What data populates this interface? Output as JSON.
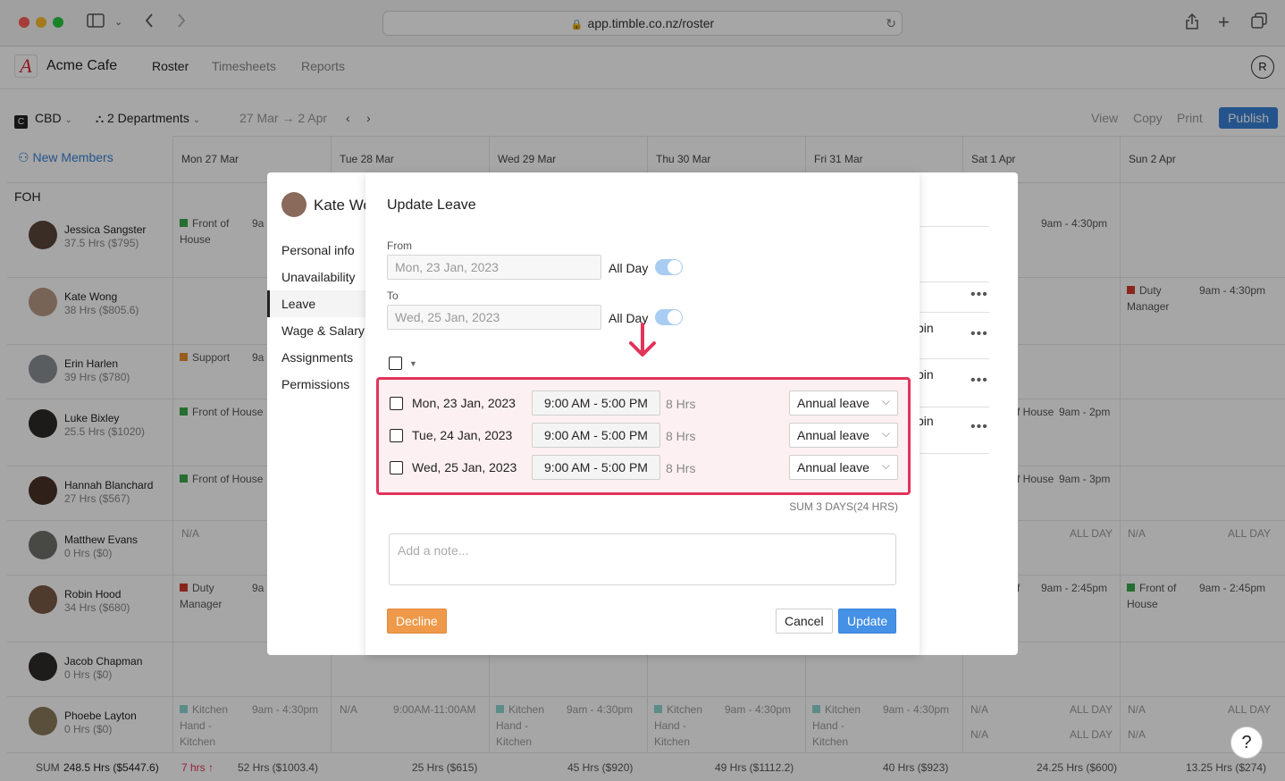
{
  "browser": {
    "url": "app.timble.co.nz/roster"
  },
  "app": {
    "logo": "A",
    "company": "Acme Cafe",
    "nav": [
      "Roster",
      "Timesheets",
      "Reports"
    ],
    "user_initial": "R"
  },
  "toolbar": {
    "location_badge": "C",
    "location": "CBD",
    "departments": "2 Departments",
    "date_range": "27 Mar → 2 Apr",
    "view": "View",
    "copy": "Copy",
    "print": "Print",
    "publish": "Publish"
  },
  "roster": {
    "new_members": "New Members",
    "section": "FOH",
    "days": [
      "Mon 27 Mar",
      "Tue 28 Mar",
      "Wed 29 Mar",
      "Thu 30 Mar",
      "Fri 31 Mar",
      "Sat 1 Apr",
      "Sun 2 Apr"
    ],
    "people": [
      {
        "name": "Jessica Sangster",
        "hours": "37.5 Hrs ($795)"
      },
      {
        "name": "Kate Wong",
        "hours": "38 Hrs ($805.6)"
      },
      {
        "name": "Erin Harlen",
        "hours": "39 Hrs ($780)"
      },
      {
        "name": "Luke Bixley",
        "hours": "25.5 Hrs ($1020)"
      },
      {
        "name": "Hannah Blanchard",
        "hours": "27 Hrs ($567)"
      },
      {
        "name": "Matthew Evans",
        "hours": "0 Hrs ($0)"
      },
      {
        "name": "Robin Hood",
        "hours": "34 Hrs ($680)"
      },
      {
        "name": "Jacob Chapman",
        "hours": "0 Hrs ($0)"
      },
      {
        "name": "Phoebe Layton",
        "hours": "0 Hrs ($0)"
      }
    ],
    "shifts": {
      "jessica_mon": "Front of House",
      "jessica_mon_time": "9a",
      "jessica_sat_time": "9am - 4:30pm",
      "kate_sun": "Duty Manager",
      "kate_sun_time": "9am - 4:30pm",
      "erin_mon": "Support",
      "erin_mon_time": "9a",
      "luke_mon": "Front of House",
      "luke_sat": "f House",
      "luke_sat_time": "9am - 2pm",
      "hannah_mon": "Front of House",
      "hannah_sat": "f House",
      "hannah_sat_time": "9am - 3pm",
      "na": "N/A",
      "all_day": "ALL DAY",
      "robin_mon": "Duty Manager",
      "robin_mon_time": "9a",
      "robin_sat": "f",
      "robin_sat_time": "9am - 2:45pm",
      "robin_sun": "Front of House",
      "robin_sun_time": "9am - 2:45pm",
      "kitchen": "Kitchen Hand - Kitchen",
      "kitchen_time": "9am - 4:30pm",
      "tue_time": "9:00AM-11:00AM"
    },
    "sums": {
      "total_label": "SUM",
      "total": "248.5 Hrs ($5447.6)",
      "alert": "7 hrs ↑",
      "mon": "52 Hrs ($1003.4)",
      "tue": "25 Hrs ($615)",
      "wed": "45 Hrs ($920)",
      "thu": "49 Hrs ($1112.2)",
      "fri": "40 Hrs ($923)",
      "sat": "24.25 Hrs ($600)",
      "sun": "13.25 Hrs ($274)"
    }
  },
  "profile_panel": {
    "name": "Kate Wo",
    "menu": [
      "Personal info",
      "Unavailability",
      "Leave",
      "Wage & Salary",
      "Assignments",
      "Permissions"
    ],
    "active": "Leave",
    "right_fragments": [
      "bin",
      "bin",
      "bin",
      "l"
    ]
  },
  "modal": {
    "title": "Update Leave",
    "from_label": "From",
    "from_value": "Mon, 23 Jan, 2023",
    "to_label": "To",
    "to_value": "Wed, 25 Jan, 2023",
    "all_day": "All Day",
    "rows": [
      {
        "date": "Mon, 23 Jan, 2023",
        "time": "9:00 AM - 5:00 PM",
        "hours": "8 Hrs",
        "type": "Annual leave"
      },
      {
        "date": "Tue, 24 Jan, 2023",
        "time": "9:00 AM - 5:00 PM",
        "hours": "8 Hrs",
        "type": "Annual leave"
      },
      {
        "date": "Wed, 25 Jan, 2023",
        "time": "9:00 AM - 5:00 PM",
        "hours": "8 Hrs",
        "type": "Annual leave"
      }
    ],
    "sum": "SUM 3 DAYS(24 HRS)",
    "note_placeholder": "Add a note...",
    "decline": "Decline",
    "cancel": "Cancel",
    "update": "Update"
  },
  "help": "?",
  "colors": {
    "accent": "#3a82d8",
    "highlight": "#e2335a",
    "decline": "#ef9a4a"
  }
}
